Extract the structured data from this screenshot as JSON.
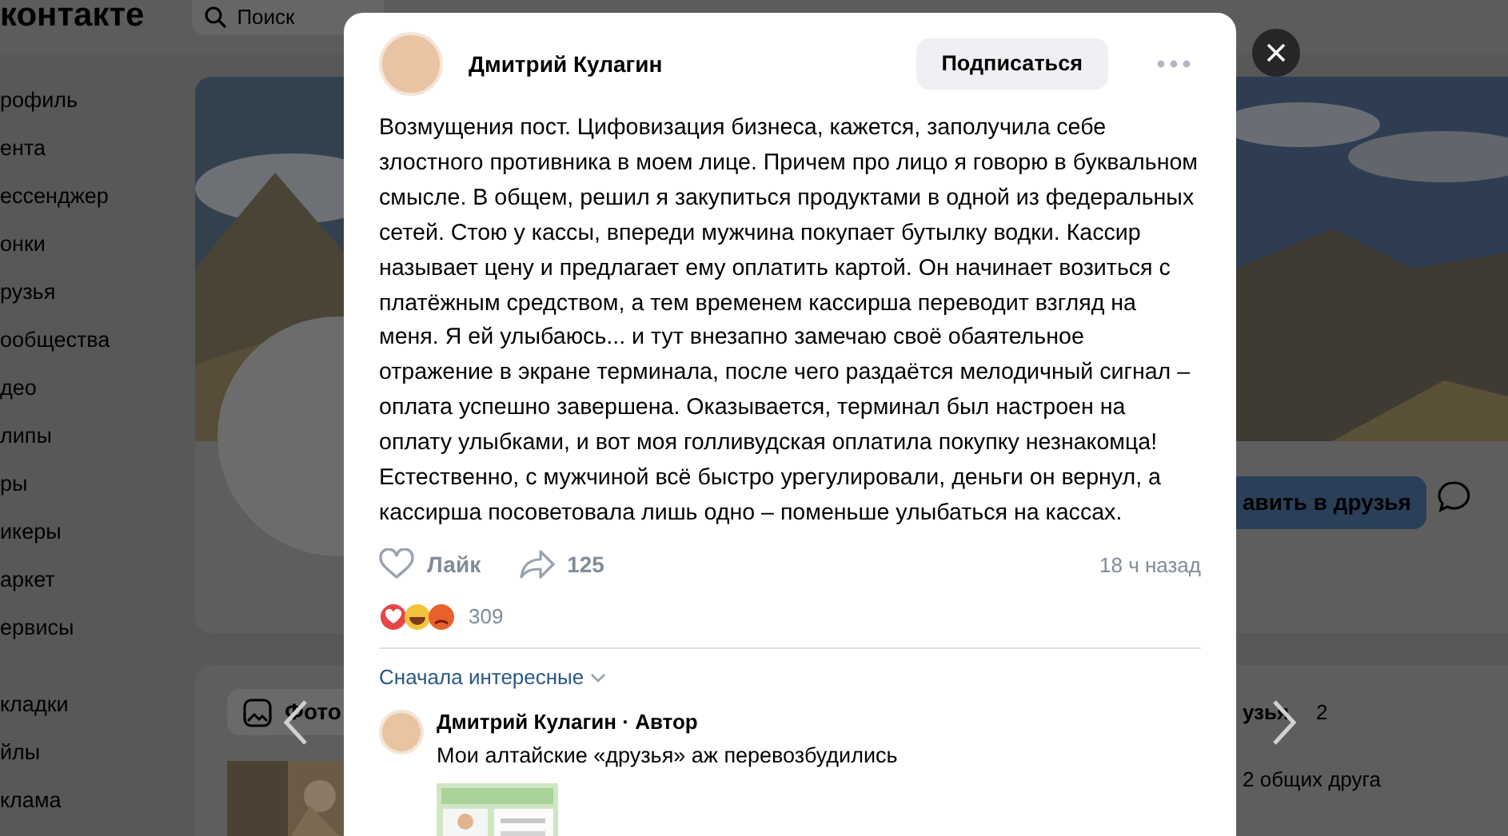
{
  "header": {
    "logo": "контакте",
    "search_placeholder": "Поиск"
  },
  "sidebar": {
    "items": [
      {
        "label": "рофиль"
      },
      {
        "label": "ента"
      },
      {
        "label": "ессенджер"
      },
      {
        "label": "онки"
      },
      {
        "label": "рузья"
      },
      {
        "label": "ообщества"
      },
      {
        "label": "део"
      },
      {
        "label": "липы"
      },
      {
        "label": "ры"
      },
      {
        "label": "икеры"
      },
      {
        "label": "аркет"
      },
      {
        "label": "ервисы"
      }
    ],
    "secondary_items": [
      {
        "label": "кладки"
      },
      {
        "label": "йлы"
      },
      {
        "label": "клама"
      }
    ]
  },
  "profile": {
    "add_friend_button": "авить в друзья",
    "photo_tab": "Фото",
    "friends_title": "узья",
    "friends_count": "2",
    "mutual_friends": "2 общих друга"
  },
  "post": {
    "author": "Дмитрий Кулагин",
    "subscribe_button": "Подписаться",
    "text": "Возмущения пост. Цифовизация бизнеса, кажется, заполучила себе злостного противника в моем лице. Причем про лицо я говорю в буквальном смысле. В общем, решил я закупиться продуктами в одной из федеральных сетей. Стою у кассы, впереди мужчина покупает бутылку водки. Кассир называет цену и предлагает ему оплатить картой. Он начинает возиться с платёжным средством, а тем временем кассирша переводит взгляд на меня. Я ей улыбаюсь... и тут внезапно замечаю своё обаятельное отражение в экране терминала, после чего раздаётся мелодичный сигнал – оплата успешно завершена. Оказывается, терминал был настроен на оплату улыбками, и вот моя голливудская оплатила покупку незнакомца! Естественно, с мужчиной всё быстро урегулировали, деньги он вернул, а кассирша посоветовала лишь одно – поменьше улыбаться на кассах.",
    "like_label": "Лайк",
    "shares": "125",
    "time": "18 ч назад",
    "reactions_count": "309",
    "sort": "Сначала интересные",
    "comments": [
      {
        "author": "Дмитрий Кулагин · Автор",
        "text": "Мои алтайские «друзья» аж перевозбудились"
      }
    ]
  }
}
